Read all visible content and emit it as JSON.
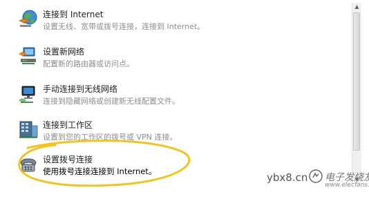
{
  "options": [
    {
      "title": "连接到 Internet",
      "description": "设置无线、宽带或拨号连接，连接到 Internet。",
      "icon": "globe-network-icon"
    },
    {
      "title": "设置新网络",
      "description": "配置新的路由器或访问点。",
      "icon": "router-setup-icon"
    },
    {
      "title": "手动连接到无线网络",
      "description": "连接到隐藏网络或创建新无线配置文件。",
      "icon": "wireless-monitor-icon"
    },
    {
      "title": "连接到工作区",
      "description": "设置到您的工作区的拨号或 VPN 连接。",
      "icon": "workplace-building-icon"
    },
    {
      "title": "设置拨号连接",
      "description": "使用拨号连接连接到 Internet。",
      "icon": "dialup-phone-icon",
      "highlighted": true
    }
  ],
  "watermark": {
    "site": "ybx8.cn",
    "cn_name": "电子发烧友",
    "url": "www.elecfans.com"
  },
  "colors": {
    "highlight_ring": "#f2c41d",
    "title_text": "#1e1e1e",
    "desc_text": "#8e8e8e"
  }
}
